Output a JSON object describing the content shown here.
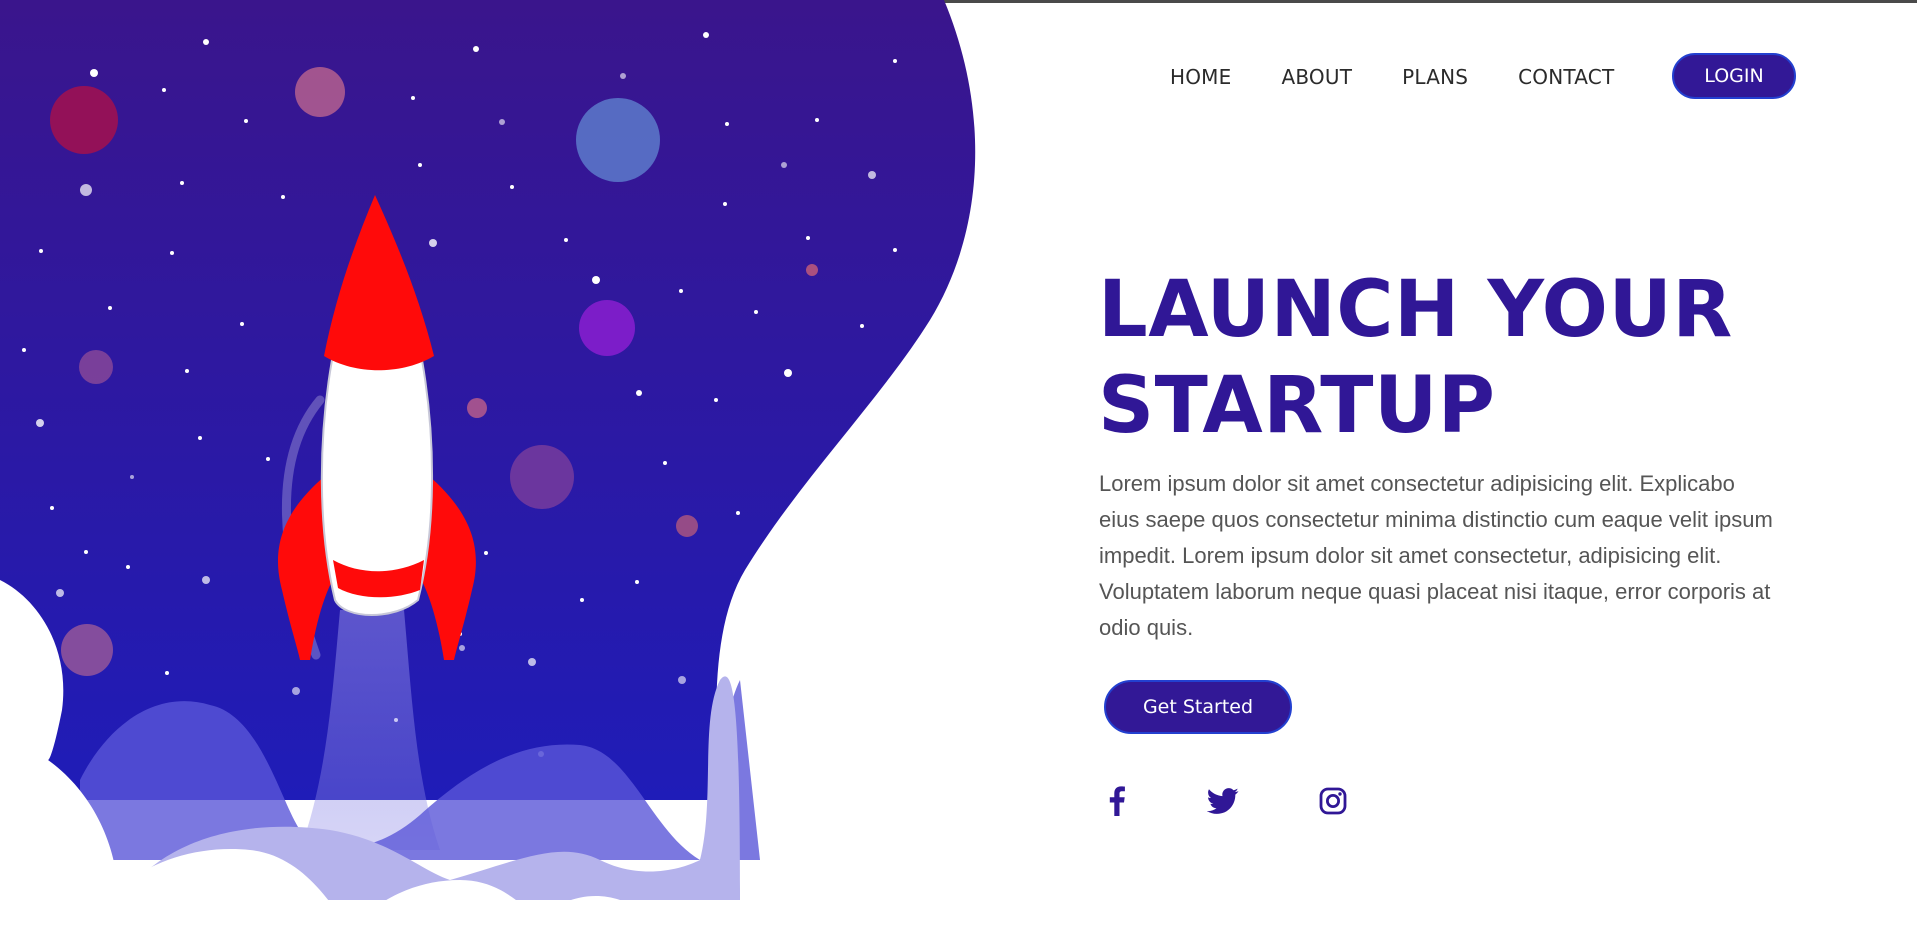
{
  "nav": {
    "items": [
      {
        "label": "HOME"
      },
      {
        "label": "ABOUT"
      },
      {
        "label": "PLANS"
      },
      {
        "label": "CONTACT"
      }
    ],
    "login_label": "LOGIN"
  },
  "hero": {
    "title_line1": "LAUNCH YOUR",
    "title_line2": "STARTUP",
    "description": "Lorem ipsum dolor sit amet consectetur adipisicing elit. Explicabo eius saepe quos consectetur minima distinctio cum eaque velit ipsum impedit. Lorem ipsum dolor sit amet consectetur, adipisicing elit. Voluptatem laborum neque quasi placeat nisi itaque, error corporis at odio quis.",
    "cta_label": "Get Started"
  },
  "social": [
    {
      "icon": "facebook-icon"
    },
    {
      "icon": "twitter-icon"
    },
    {
      "icon": "instagram-icon"
    }
  ],
  "colors": {
    "brand": "#321896",
    "space_top": "#3a158c",
    "space_bottom": "#1f1cb8",
    "rocket_red": "#ff0a0a",
    "text": "#555555"
  }
}
